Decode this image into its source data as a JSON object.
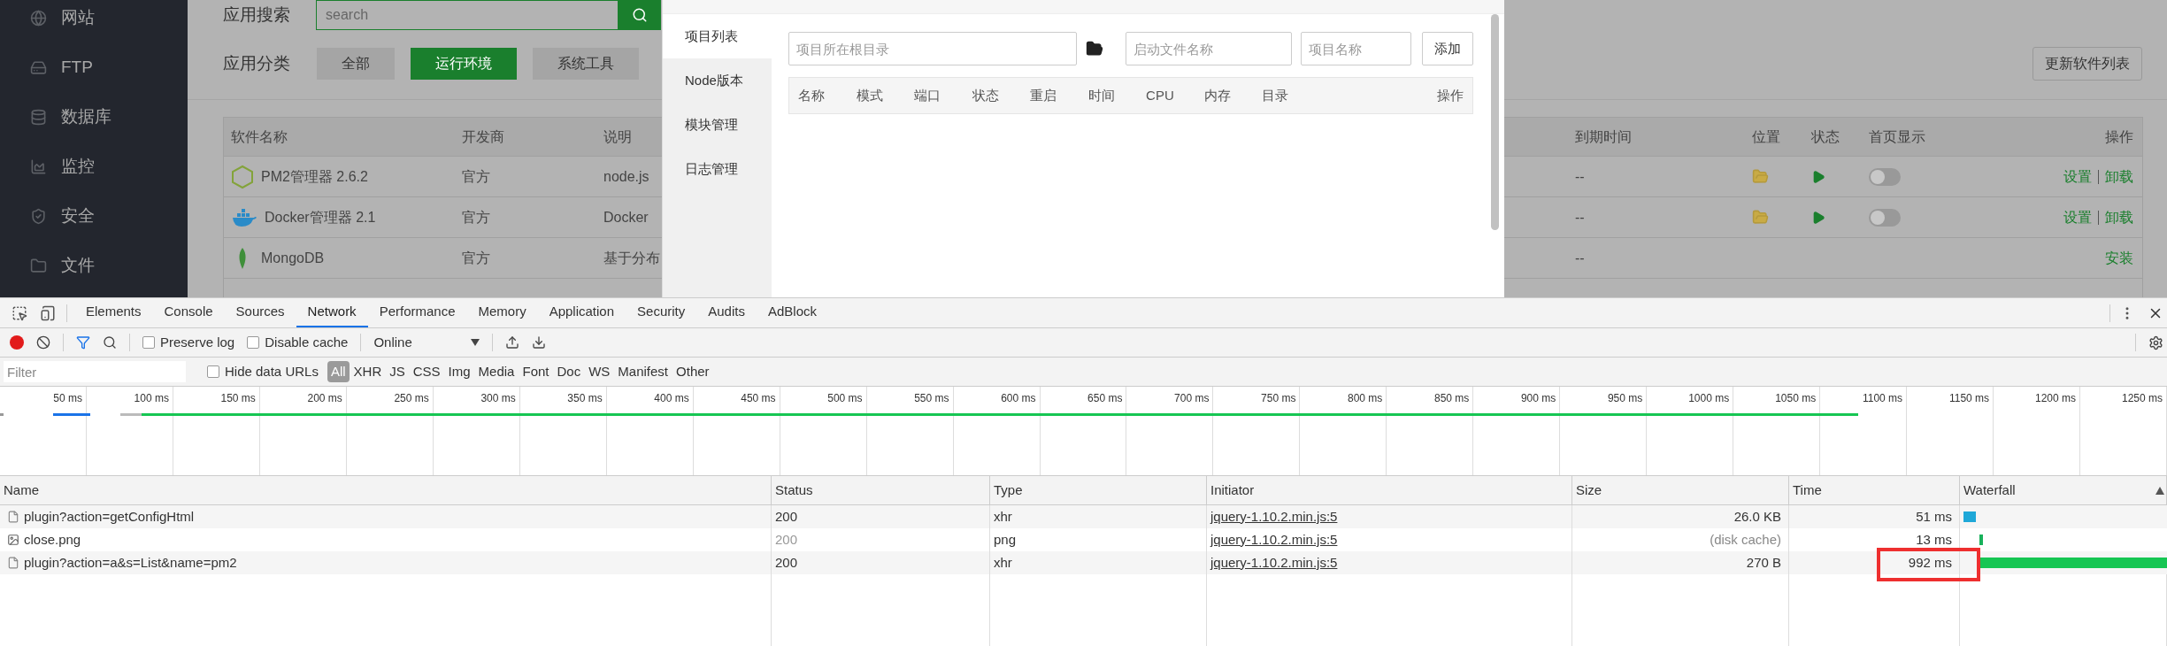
{
  "sidebar": {
    "items": [
      {
        "label": "网站"
      },
      {
        "label": "FTP"
      },
      {
        "label": "数据库"
      },
      {
        "label": "监控"
      },
      {
        "label": "安全"
      },
      {
        "label": "文件"
      }
    ]
  },
  "app_store": {
    "search_label": "应用搜索",
    "search": {
      "placeholder": "search"
    },
    "category_label": "应用分类",
    "categories": [
      {
        "label": "全部",
        "selected": false
      },
      {
        "label": "运行环境",
        "selected": true
      },
      {
        "label": "系统工具",
        "selected": false
      }
    ],
    "update_button": "更新软件列表",
    "table": {
      "columns": [
        "软件名称",
        "开发商",
        "说明",
        "到期时间",
        "位置",
        "状态",
        "首页显示",
        "操作"
      ],
      "rows": [
        {
          "kind": "installed",
          "name": "PM2管理器 2.6.2",
          "developer": "官方",
          "description": "node.js",
          "expires": "--",
          "running": true,
          "home_display": {
            "on": false
          },
          "actions": [
            "设置",
            "卸载"
          ]
        },
        {
          "kind": "installed",
          "name": "Docker管理器 2.1",
          "developer": "官方",
          "description": "Docker",
          "expires": "--",
          "running": true,
          "home_display": {
            "on": false
          },
          "actions": [
            "设置",
            "卸载"
          ]
        },
        {
          "kind": "available",
          "name": "MongoDB",
          "developer": "官方",
          "description": "基于分布",
          "expires": "--",
          "actions": [
            "安装"
          ]
        }
      ]
    }
  },
  "modal": {
    "tabs": [
      {
        "label": "项目列表",
        "selected": true
      },
      {
        "label": "Node版本",
        "selected": false
      },
      {
        "label": "模块管理",
        "selected": false
      },
      {
        "label": "日志管理",
        "selected": false
      }
    ],
    "root_dir": {
      "placeholder": "项目所在根目录"
    },
    "start_file": {
      "placeholder": "启动文件名称"
    },
    "project_name": {
      "placeholder": "项目名称"
    },
    "add_button": "添加",
    "columns": [
      "名称",
      "模式",
      "端口",
      "状态",
      "重启",
      "时间",
      "CPU",
      "内存",
      "目录",
      "操作"
    ]
  },
  "devtools": {
    "panel_tabs": [
      {
        "label": "Elements",
        "selected": false
      },
      {
        "label": "Console",
        "selected": false
      },
      {
        "label": "Sources",
        "selected": false
      },
      {
        "label": "Network",
        "selected": true
      },
      {
        "label": "Performance",
        "selected": false
      },
      {
        "label": "Memory",
        "selected": false
      },
      {
        "label": "Application",
        "selected": false
      },
      {
        "label": "Security",
        "selected": false
      },
      {
        "label": "Audits",
        "selected": false
      },
      {
        "label": "AdBlock",
        "selected": false
      }
    ],
    "toolbar": {
      "recording": true,
      "preserve_log": {
        "label": "Preserve log",
        "checked": false
      },
      "disable_cache": {
        "label": "Disable cache",
        "checked": false
      },
      "throttling": "Online"
    },
    "filter": {
      "placeholder": "Filter",
      "hide_data_urls": {
        "label": "Hide data URLs",
        "checked": false
      },
      "types": [
        {
          "label": "All",
          "selected": true
        },
        {
          "label": "XHR",
          "selected": false
        },
        {
          "label": "JS",
          "selected": false
        },
        {
          "label": "CSS",
          "selected": false
        },
        {
          "label": "Img",
          "selected": false
        },
        {
          "label": "Media",
          "selected": false
        },
        {
          "label": "Font",
          "selected": false
        },
        {
          "label": "Doc",
          "selected": false
        },
        {
          "label": "WS",
          "selected": false
        },
        {
          "label": "Manifest",
          "selected": false
        },
        {
          "label": "Other",
          "selected": false
        }
      ]
    },
    "timeline_ticks": [
      "50 ms",
      "100 ms",
      "150 ms",
      "200 ms",
      "250 ms",
      "300 ms",
      "350 ms",
      "400 ms",
      "450 ms",
      "500 ms",
      "550 ms",
      "600 ms",
      "650 ms",
      "700 ms",
      "750 ms",
      "800 ms",
      "850 ms",
      "900 ms",
      "950 ms",
      "1000 ms",
      "1050 ms",
      "1100 ms",
      "1150 ms",
      "1200 ms",
      "1250 ms"
    ],
    "network_table": {
      "columns": [
        "Name",
        "Status",
        "Type",
        "Initiator",
        "Size",
        "Time",
        "Waterfall"
      ],
      "rows": [
        {
          "kind": "document",
          "name": "plugin?action=getConfigHtml",
          "status": "200",
          "from_cache": false,
          "type": "xhr",
          "initiator": "jquery-1.10.2.min.js:5",
          "size": "26.0 KB",
          "time": "51 ms",
          "highlighted": false
        },
        {
          "kind": "image",
          "name": "close.png",
          "status": "200",
          "from_cache": true,
          "type": "png",
          "initiator": "jquery-1.10.2.min.js:5",
          "size": "(disk cache)",
          "time": "13 ms",
          "highlighted": false
        },
        {
          "kind": "document",
          "name": "plugin?action=a&s=List&name=pm2",
          "status": "200",
          "from_cache": false,
          "type": "xhr",
          "initiator": "jquery-1.10.2.min.js:5",
          "size": "270 B",
          "time": "992 ms",
          "highlighted": true
        }
      ]
    }
  }
}
